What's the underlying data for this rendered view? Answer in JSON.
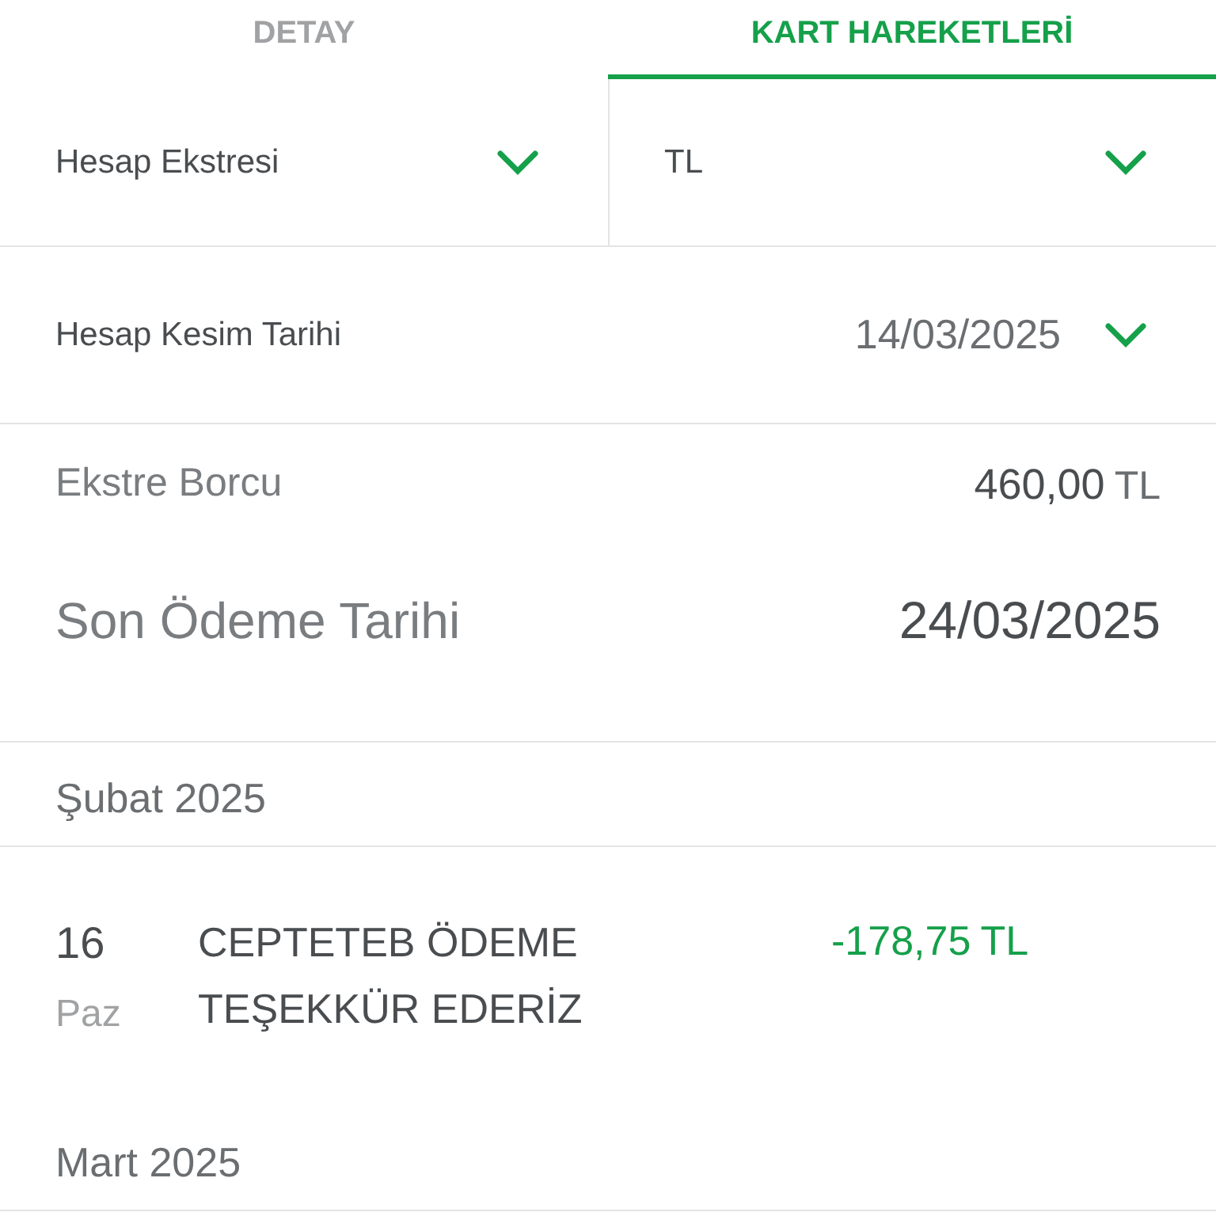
{
  "tabs": [
    {
      "label": "DETAY",
      "selected": false
    },
    {
      "label": "KART HAREKETLERİ",
      "selected": true
    }
  ],
  "filters": [
    {
      "value": "Hesap Ekstresi"
    },
    {
      "value": "TL"
    }
  ],
  "statement_date": {
    "label": "Hesap Kesim Tarihi",
    "value": "14/03/2025"
  },
  "summary": [
    {
      "label": "Ekstre Borcu",
      "amount": "460,00",
      "currency": "TL",
      "kind": "small"
    },
    {
      "label": "Son Ödeme Tarihi",
      "amount": "24/03/2025",
      "kind": "large"
    }
  ],
  "groups": [
    {
      "title": "Şubat 2025",
      "transactions": [
        {
          "day": "16",
          "weekday": "Paz",
          "description": "CEPTETEB ÖDEME TEŞEKKÜR EDERİZ",
          "amount": "-178,75",
          "currency": "TL"
        }
      ]
    },
    {
      "title": "Mart 2025"
    }
  ]
}
